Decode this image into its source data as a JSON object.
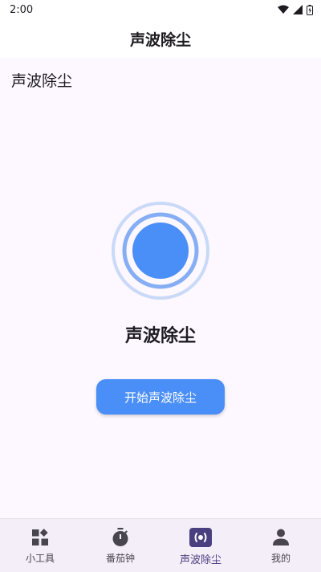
{
  "status_bar": {
    "time": "2:00"
  },
  "app_bar": {
    "title": "声波除尘"
  },
  "page": {
    "label": "声波除尘",
    "main_title": "声波除尘",
    "start_button_label": "开始声波除尘"
  },
  "colors": {
    "accent": "#4a8ef7",
    "ring_outer": "#c9d9f8",
    "ring_inner": "#86aef5",
    "nav_active": "#4a3f7f",
    "background": "#fdf7ff"
  },
  "bottom_nav": {
    "items": [
      {
        "label": "小工具",
        "icon": "widgets-icon"
      },
      {
        "label": "番茄钟",
        "icon": "timer-icon"
      },
      {
        "label": "声波除尘",
        "icon": "speaker-wave-icon",
        "active": true
      },
      {
        "label": "我的",
        "icon": "person-icon"
      }
    ]
  }
}
